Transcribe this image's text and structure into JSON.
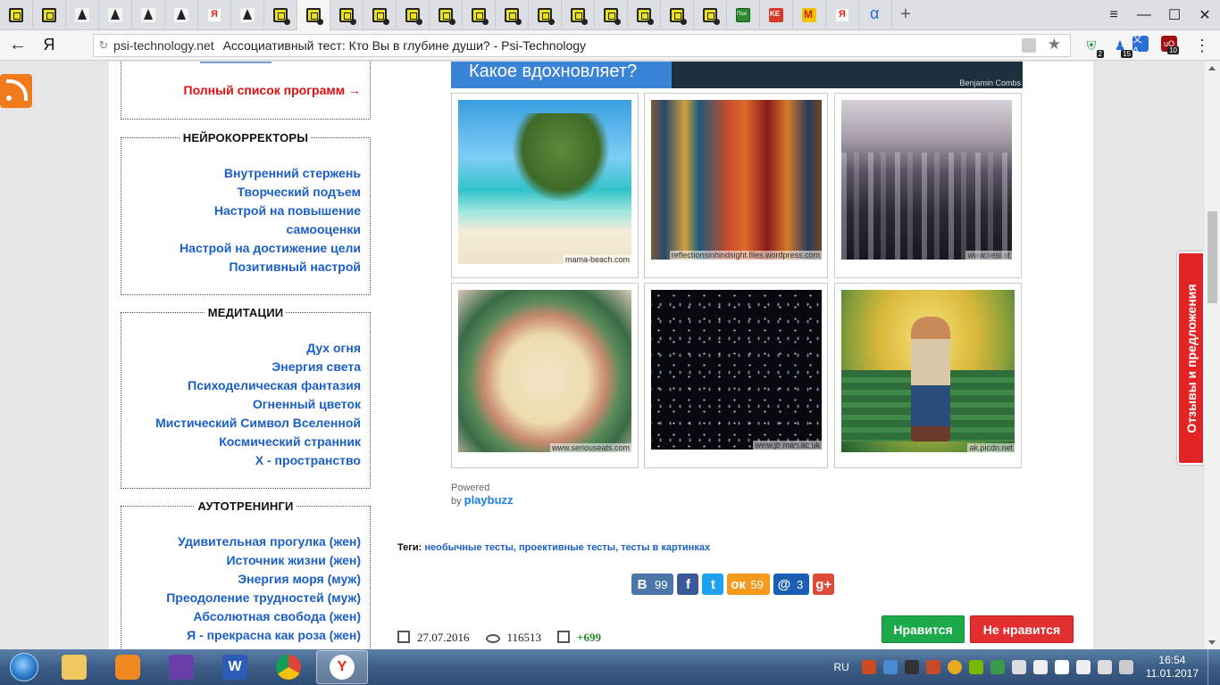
{
  "browser": {
    "tabs": [
      {
        "icon": "psi-icon"
      },
      {
        "icon": "psi-icon"
      },
      {
        "icon": "chess-icon"
      },
      {
        "icon": "chess-icon"
      },
      {
        "icon": "chess-icon"
      },
      {
        "icon": "chess-icon"
      },
      {
        "icon": "yandex-icon"
      },
      {
        "icon": "chess-icon"
      },
      {
        "icon": "psi-icon"
      },
      {
        "icon": "psi-icon",
        "active": true
      },
      {
        "icon": "psi-icon"
      },
      {
        "icon": "psi-icon"
      },
      {
        "icon": "psi-icon"
      },
      {
        "icon": "psi-icon"
      },
      {
        "icon": "psi-icon"
      },
      {
        "icon": "psi-icon"
      },
      {
        "icon": "psi-icon"
      },
      {
        "icon": "psi-icon"
      },
      {
        "icon": "psi-icon"
      },
      {
        "icon": "psi-icon"
      },
      {
        "icon": "psi-icon"
      },
      {
        "icon": "psi-icon"
      },
      {
        "icon": "psi-green-icon"
      },
      {
        "icon": "ke-icon"
      },
      {
        "icon": "m-icon"
      },
      {
        "icon": "yandex-icon"
      },
      {
        "icon": "alpha-icon"
      }
    ],
    "back": "←",
    "yandex_logo": "Я",
    "url_host": "psi-technology.net",
    "page_title": "Ассоциативный тест: Кто Вы в глубине души? - Psi-Technology",
    "ext_badges": [
      "2",
      "15",
      "",
      "10"
    ]
  },
  "sidebar": {
    "programs_link": "Полный список программ →",
    "neuro": {
      "title": "НЕЙРОКОРРЕКТОРЫ",
      "items": [
        "Внутренний стержень",
        "Творческий подъем",
        "Настрой на повышение",
        "самооценки",
        "Настрой на достижение цели",
        "Позитивный настрой"
      ]
    },
    "meditation": {
      "title": "МЕДИТАЦИИ",
      "items": [
        "Дух огня",
        "Энергия света",
        "Психоделическая фантазия",
        "Огненный цветок",
        "Мистический Символ Вселенной",
        "Космический странник",
        "Х - пространство"
      ]
    },
    "autotraining": {
      "title": "АУТОТРЕНИНГИ",
      "items": [
        "Удивительная прогулка (жен)",
        "Источник жизни (жен)",
        "Энергия моря (муж)",
        "Преодоление трудностей (муж)",
        "Абсолютная свобода (жен)",
        "Я - прекрасна как роза (жен)"
      ]
    }
  },
  "quiz": {
    "question": "Какое вдохновляет?",
    "photo_credit": "Benjamin Combs",
    "images": [
      {
        "caption": "mama-beach.com"
      },
      {
        "caption": "reflectionsinhindsight.files.wordpress.com"
      },
      {
        "caption": "www.sesi.at"
      },
      {
        "caption": "www.seriouseats.com"
      },
      {
        "caption": "www.jb.man.ac.uk"
      },
      {
        "caption": "ak.picdn.net"
      }
    ],
    "powered_by": "Powered by",
    "powered_brand": "playbuzz"
  },
  "tags": {
    "label": "Теги:",
    "values": "необычные тесты, проективные тесты, тесты в картинках"
  },
  "share": [
    {
      "name": "vk",
      "icon": "В",
      "count": "99",
      "color": "#4a76a8"
    },
    {
      "name": "facebook",
      "icon": "f",
      "count": "",
      "color": "#3b5998"
    },
    {
      "name": "twitter",
      "icon": "t",
      "count": "",
      "color": "#1da1f2"
    },
    {
      "name": "odnoklassniki",
      "icon": "ок",
      "count": "59",
      "color": "#f59a1e"
    },
    {
      "name": "mailru",
      "icon": "@",
      "count": "3",
      "color": "#1a5fb4"
    },
    {
      "name": "googleplus",
      "icon": "g+",
      "count": "",
      "color": "#dd4b39"
    }
  ],
  "meta": {
    "date": "27.07.2016",
    "views": "116513",
    "rating": "+699"
  },
  "buttons": {
    "like": "Нравится",
    "dislike": "Не нравится"
  },
  "feedback_tab": "Отзывы и предложения",
  "taskbar": {
    "lang": "RU",
    "time": "16:54",
    "date": "11.01.2017"
  }
}
